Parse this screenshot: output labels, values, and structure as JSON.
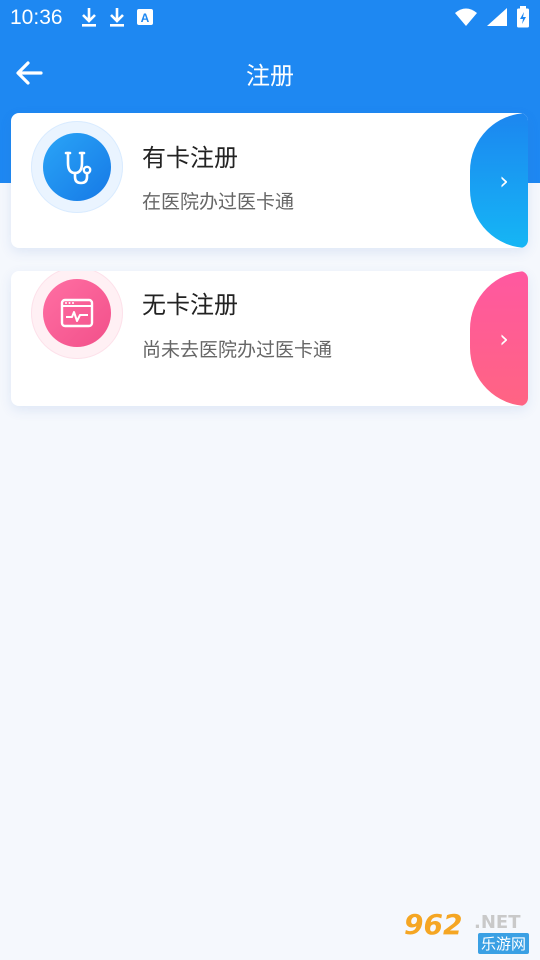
{
  "status_bar": {
    "time": "10:36",
    "left_icons": [
      "download-icon",
      "download-icon",
      "a-icon"
    ],
    "right_icons": [
      "wifi-icon",
      "signal-icon",
      "battery-icon"
    ]
  },
  "app_bar": {
    "title": "注册",
    "back_icon": "arrow-left-icon"
  },
  "cards": [
    {
      "title": "有卡注册",
      "subtitle": "在医院办过医卡通",
      "icon": "stethoscope-icon",
      "accent": "#1e88f2",
      "chevron": "›"
    },
    {
      "title": "无卡注册",
      "subtitle": "尚未去医院办过医卡通",
      "icon": "heartbeat-monitor-icon",
      "accent": "#f2508a",
      "chevron": "›"
    }
  ],
  "watermark": {
    "number": "962",
    "domain": ".NET",
    "text": "乐游网"
  },
  "colors": {
    "header": "#1e88f2",
    "background": "#f5f8fd"
  }
}
